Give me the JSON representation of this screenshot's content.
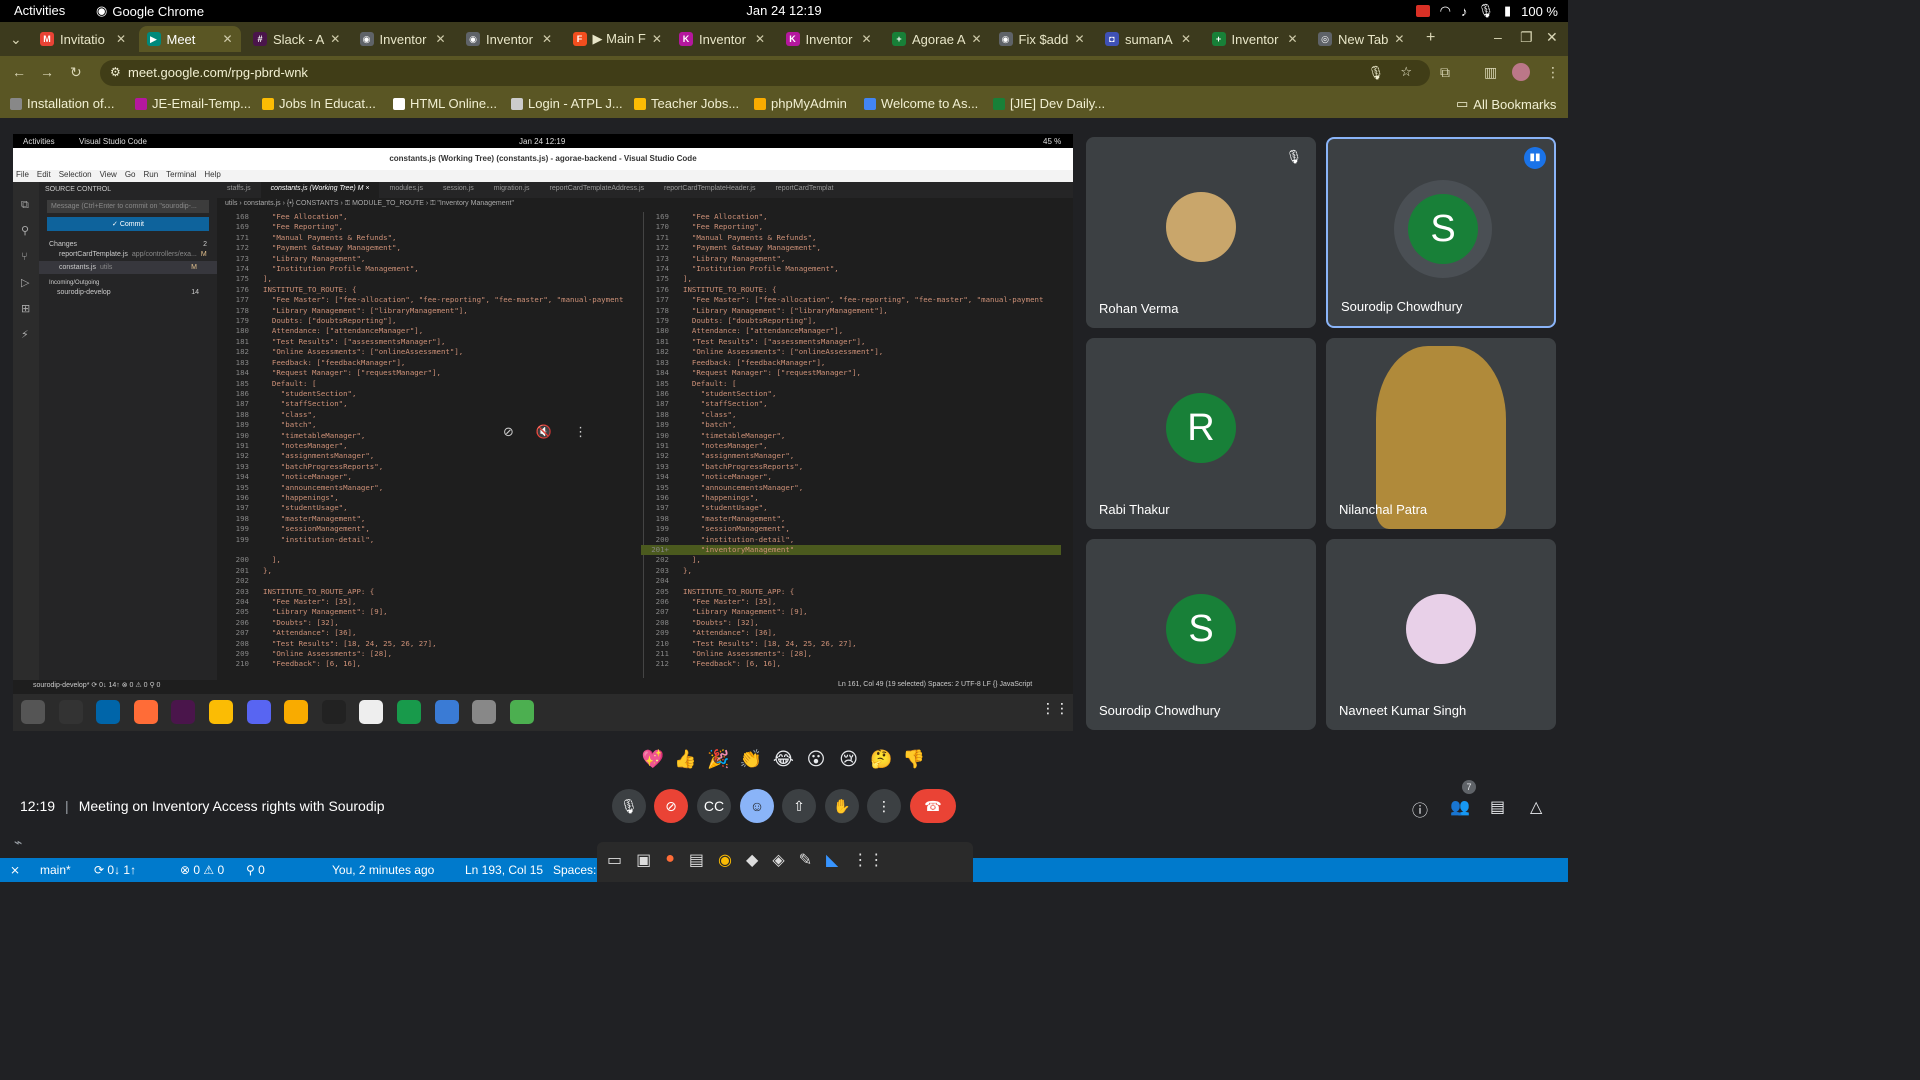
{
  "topbar": {
    "activities": "Activities",
    "app": "Google Chrome",
    "clock": "Jan 24  12:19",
    "battery": "100 %"
  },
  "tabs": [
    {
      "label": "Invitatio",
      "color": "#ea4335",
      "glyph": "M"
    },
    {
      "label": "Meet",
      "color": "#00897b",
      "glyph": "▶",
      "active": true
    },
    {
      "label": "Slack - A",
      "color": "#4a154b",
      "glyph": "#"
    },
    {
      "label": "Inventor",
      "color": "#5f6368",
      "glyph": "◉"
    },
    {
      "label": "Inventor",
      "color": "#5f6368",
      "glyph": "◉"
    },
    {
      "label": "▶ Main F",
      "color": "#f24e1e",
      "glyph": "F"
    },
    {
      "label": "Inventor",
      "color": "#b5179e",
      "glyph": "K"
    },
    {
      "label": "Inventor",
      "color": "#b5179e",
      "glyph": "K"
    },
    {
      "label": "Agorae A",
      "color": "#188038",
      "glyph": "+"
    },
    {
      "label": "Fix $add",
      "color": "#5f6368",
      "glyph": "◉"
    },
    {
      "label": "sumanA",
      "color": "#3f51b5",
      "glyph": "◘"
    },
    {
      "label": "Inventor",
      "color": "#188038",
      "glyph": "+"
    },
    {
      "label": "New Tab",
      "color": "#5f6368",
      "glyph": "◎"
    }
  ],
  "omnibar": {
    "url": "meet.google.com/rpg-pbrd-wnk"
  },
  "bookmarks": [
    {
      "label": "Installation of...",
      "color": "#888"
    },
    {
      "label": "JE-Email-Temp...",
      "color": "#b5179e"
    },
    {
      "label": "Jobs In Educat...",
      "color": "#fbbc04"
    },
    {
      "label": "HTML Online...",
      "color": "#fff"
    },
    {
      "label": "Login - ATPL J...",
      "color": "#ccc"
    },
    {
      "label": "Teacher Jobs...",
      "color": "#fbbc04"
    },
    {
      "label": "phpMyAdmin",
      "color": "#f9ab00"
    },
    {
      "label": "Welcome to As...",
      "color": "#4285f4"
    },
    {
      "label": "[JIE] Dev Daily...",
      "color": "#188038"
    }
  ],
  "all_bookmarks": "All Bookmarks",
  "vscode": {
    "top_activities": "Activities",
    "top_app": "Visual Studio Code",
    "top_clock": "Jan 24  12:19",
    "top_batt": "45 %",
    "title": "constants.js (Working Tree) (constants.js) - agorae-backend - Visual Studio Code",
    "menu": [
      "File",
      "Edit",
      "Selection",
      "View",
      "Go",
      "Run",
      "Terminal",
      "Help"
    ],
    "side_title": "SOURCE CONTROL",
    "commit_placeholder": "Message (Ctrl+Enter to commit on \"sourodip-...",
    "commit_label": "✓ Commit",
    "changes": "Changes",
    "changes_count": "2",
    "file1": "reportCardTemplate.js",
    "file1_path": "app/controllers/exa...",
    "file1_flag": "M",
    "file2": "constants.js",
    "file2_path": "utils",
    "file2_flag": "M",
    "incoming": "Incoming/Outgoing",
    "branch": "sourodip-develop",
    "branch_count": "14",
    "tabs": [
      "staffs.js",
      "constants.js (Working Tree) M ×",
      "modules.js",
      "session.js",
      "migration.js",
      "reportCardTemplateAddress.js",
      "reportCardTemplateHeader.js",
      "reportCardTemplat"
    ],
    "crumb": "utils › constants.js › {•} CONSTANTS › ⚿ MODULE_TO_ROUTE › ⚿ \"Inventory Management\"",
    "status_left": "sourodip-develop*  ⟳ 0↓ 14↑   ⊗ 0 ⚠ 0   ⚲ 0",
    "status_right": "Ln 161, Col 49 (19 selected)   Spaces: 2   UTF-8   LF   {} JavaScript"
  },
  "code_left": [
    [
      "168",
      "  \"Fee Allocation\","
    ],
    [
      "169",
      "  \"Fee Reporting\","
    ],
    [
      "171",
      "  \"Manual Payments & Refunds\","
    ],
    [
      "172",
      "  \"Payment Gateway Management\","
    ],
    [
      "173",
      "  \"Library Management\","
    ],
    [
      "174",
      "  \"Institution Profile Management\","
    ],
    [
      "175",
      "],"
    ],
    [
      "176",
      "INSTITUTE_TO_ROUTE: {"
    ],
    [
      "177",
      "  \"Fee Master\": [\"fee-allocation\", \"fee-reporting\", \"fee-master\", \"manual-payment"
    ],
    [
      "178",
      "  \"Library Management\": [\"libraryManagement\"],"
    ],
    [
      "179",
      "  Doubts: [\"doubtsReporting\"],"
    ],
    [
      "180",
      "  Attendance: [\"attendanceManager\"],"
    ],
    [
      "181",
      "  \"Test Results\": [\"assessmentsManager\"],"
    ],
    [
      "182",
      "  \"Online Assessments\": [\"onlineAssessment\"],"
    ],
    [
      "183",
      "  Feedback: [\"feedbackManager\"],"
    ],
    [
      "184",
      "  \"Request Manager\": [\"requestManager\"],"
    ],
    [
      "185",
      "  Default: ["
    ],
    [
      "186",
      "    \"studentSection\","
    ],
    [
      "187",
      "    \"staffSection\","
    ],
    [
      "188",
      "    \"class\","
    ],
    [
      "189",
      "    \"batch\","
    ],
    [
      "190",
      "    \"timetableManager\","
    ],
    [
      "191",
      "    \"notesManager\","
    ],
    [
      "192",
      "    \"assignmentsManager\","
    ],
    [
      "193",
      "    \"batchProgressReports\","
    ],
    [
      "194",
      "    \"noticeManager\","
    ],
    [
      "195",
      "    \"announcementsManager\","
    ],
    [
      "196",
      "    \"happenings\","
    ],
    [
      "197",
      "    \"studentUsage\","
    ],
    [
      "198",
      "    \"masterManagement\","
    ],
    [
      "199",
      "    \"sessionManagement\","
    ],
    [
      "199",
      "    \"institution-detail\","
    ],
    [
      "",
      ""
    ],
    [
      "200",
      "  ],"
    ],
    [
      "201",
      "},"
    ],
    [
      "202",
      ""
    ],
    [
      "203",
      "INSTITUTE_TO_ROUTE_APP: {"
    ],
    [
      "204",
      "  \"Fee Master\": [35],"
    ],
    [
      "205",
      "  \"Library Management\": [9],"
    ],
    [
      "206",
      "  \"Doubts\": [32],"
    ],
    [
      "207",
      "  \"Attendance\": [36],"
    ],
    [
      "208",
      "  \"Test Results\": [18, 24, 25, 26, 27],"
    ],
    [
      "209",
      "  \"Online Assessments\": [28],"
    ],
    [
      "210",
      "  \"Feedback\": [6, 16],"
    ]
  ],
  "code_right": [
    [
      "169",
      "  \"Fee Allocation\","
    ],
    [
      "170",
      "  \"Fee Reporting\","
    ],
    [
      "171",
      "  \"Manual Payments & Refunds\","
    ],
    [
      "172",
      "  \"Payment Gateway Management\","
    ],
    [
      "173",
      "  \"Library Management\","
    ],
    [
      "174",
      "  \"Institution Profile Management\","
    ],
    [
      "175",
      "],"
    ],
    [
      "176",
      "INSTITUTE_TO_ROUTE: {"
    ],
    [
      "177",
      "  \"Fee Master\": [\"fee-allocation\", \"fee-reporting\", \"fee-master\", \"manual-payment"
    ],
    [
      "178",
      "  \"Library Management\": [\"libraryManagement\"],"
    ],
    [
      "179",
      "  Doubts: [\"doubtsReporting\"],"
    ],
    [
      "180",
      "  Attendance: [\"attendanceManager\"],"
    ],
    [
      "181",
      "  \"Test Results\": [\"assessmentsManager\"],"
    ],
    [
      "182",
      "  \"Online Assessments\": [\"onlineAssessment\"],"
    ],
    [
      "183",
      "  Feedback: [\"feedbackManager\"],"
    ],
    [
      "184",
      "  \"Request Manager\": [\"requestManager\"],"
    ],
    [
      "185",
      "  Default: ["
    ],
    [
      "186",
      "    \"studentSection\","
    ],
    [
      "187",
      "    \"staffSection\","
    ],
    [
      "188",
      "    \"class\","
    ],
    [
      "189",
      "    \"batch\","
    ],
    [
      "190",
      "    \"timetableManager\","
    ],
    [
      "191",
      "    \"notesManager\","
    ],
    [
      "192",
      "    \"assignmentsManager\","
    ],
    [
      "193",
      "    \"batchProgressReports\","
    ],
    [
      "194",
      "    \"noticeManager\","
    ],
    [
      "195",
      "    \"announcementsManager\","
    ],
    [
      "196",
      "    \"happenings\","
    ],
    [
      "197",
      "    \"studentUsage\","
    ],
    [
      "198",
      "    \"masterManagement\","
    ],
    [
      "199",
      "    \"sessionManagement\","
    ],
    [
      "200",
      "    \"institution-detail\","
    ],
    [
      "201+",
      "    \"inventoryManagement\""
    ],
    [
      "202",
      "  ],"
    ],
    [
      "203",
      "},"
    ],
    [
      "204",
      ""
    ],
    [
      "205",
      "INSTITUTE_TO_ROUTE_APP: {"
    ],
    [
      "206",
      "  \"Fee Master\": [35],"
    ],
    [
      "207",
      "  \"Library Management\": [9],"
    ],
    [
      "208",
      "  \"Doubts\": [32],"
    ],
    [
      "209",
      "  \"Attendance\": [36],"
    ],
    [
      "210",
      "  \"Test Results\": [18, 24, 25, 26, 27],"
    ],
    [
      "211",
      "  \"Online Assessments\": [28],"
    ],
    [
      "212",
      "  \"Feedback\": [6, 16],"
    ]
  ],
  "participants": [
    {
      "name": "Rohan Verma",
      "kind": "photo"
    },
    {
      "name": "Sourodip Chowdhury",
      "kind": "avatar",
      "letter": "S",
      "color": "#188038",
      "speaking": true
    },
    {
      "name": "Rabi Thakur",
      "kind": "avatar",
      "letter": "R",
      "color": "#188038"
    },
    {
      "name": "Nilanchal Patra",
      "kind": "photo"
    },
    {
      "name": "Sourodip Chowdhury",
      "kind": "avatar",
      "letter": "S",
      "color": "#188038"
    },
    {
      "name": "Navneet Kumar Singh",
      "kind": "photo"
    }
  ],
  "reactions": [
    "💖",
    "👍",
    "🎉",
    "👏",
    "😂",
    "😮",
    "😢",
    "🤔",
    "👎"
  ],
  "meeting": {
    "time": "12:19",
    "title": "Meeting on Inventory Access rights with Sourodip",
    "people_count": "7"
  },
  "statusbar": {
    "branch": "main*",
    "sync": "⟳ 0↓ 1↑",
    "problems": "⊗ 0 ⚠ 0",
    "ports": "⚲ 0",
    "blame": "You, 2 minutes ago",
    "cursor": "Ln 193, Col 15",
    "spaces": "Spaces:"
  }
}
